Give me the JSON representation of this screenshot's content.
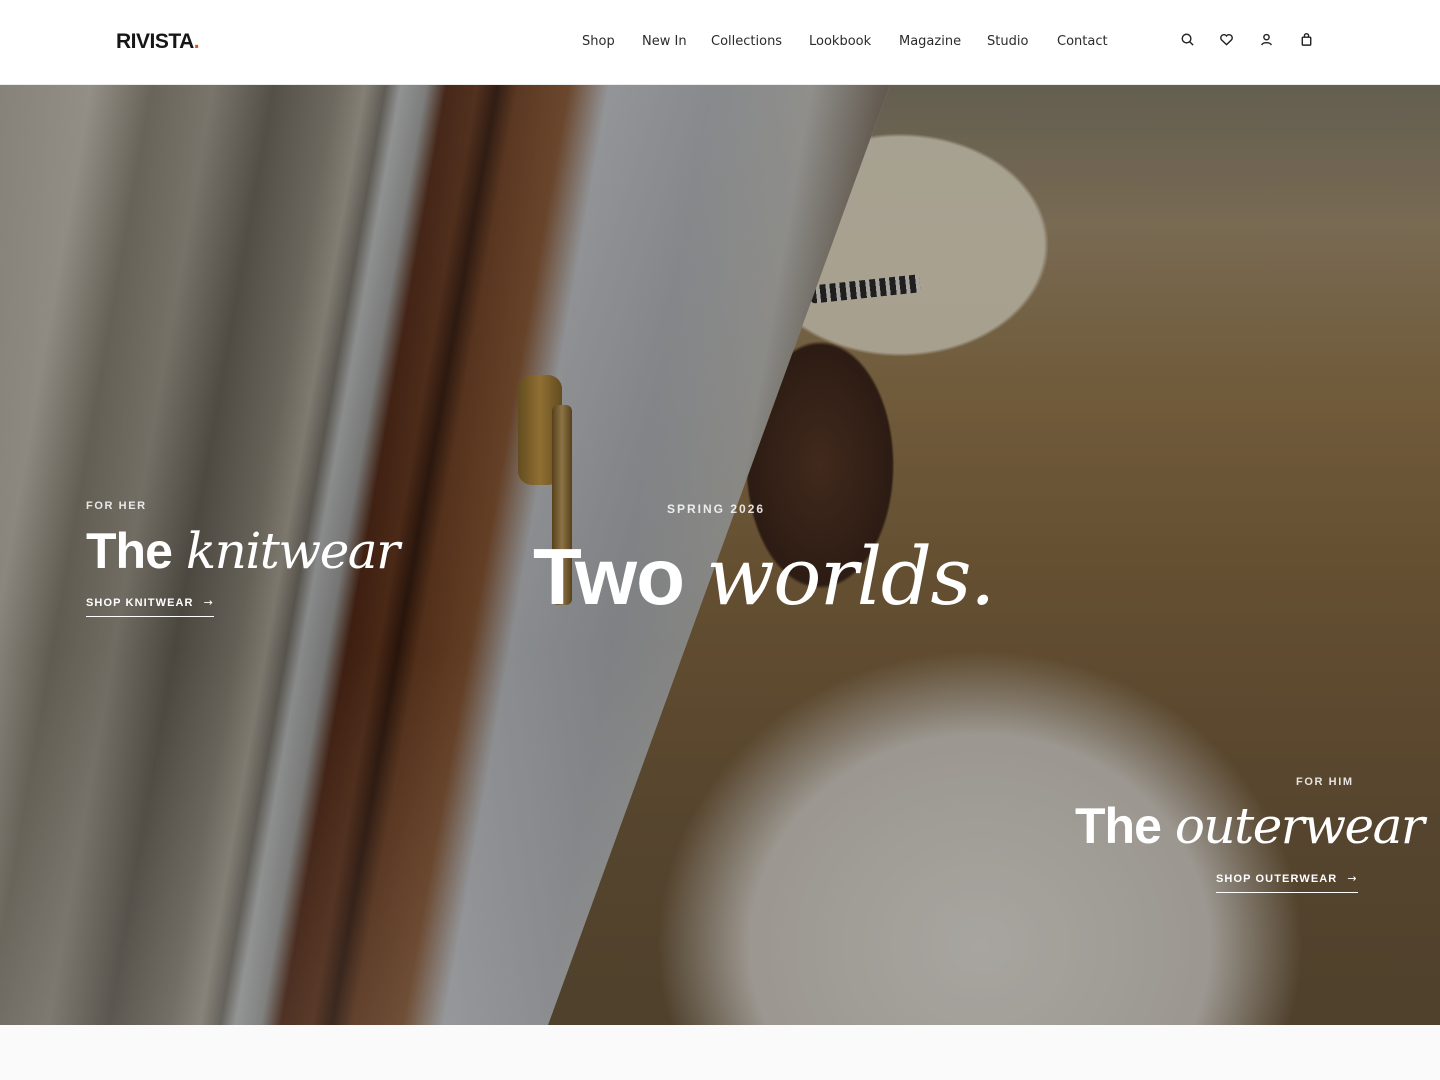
{
  "brand": {
    "name": "RIVISTA",
    "dot": ".",
    "accent_color": "#d9542a"
  },
  "nav": {
    "items": [
      {
        "label": "Shop"
      },
      {
        "label": "New In"
      },
      {
        "label": "Collections"
      },
      {
        "label": "Lookbook"
      },
      {
        "label": "Magazine"
      },
      {
        "label": "Studio"
      },
      {
        "label": "Contact"
      }
    ]
  },
  "header_icons": [
    "search-icon",
    "heart-icon",
    "user-icon",
    "bag-icon"
  ],
  "hero": {
    "center": {
      "eyebrow": "SPRING 2026",
      "title_sans": "Two",
      "title_serif": "worlds."
    },
    "left": {
      "eyebrow": "FOR HER",
      "title_sans": "The",
      "title_serif": "knitwear",
      "cta": "SHOP KNITWEAR"
    },
    "right": {
      "eyebrow": "FOR HIM",
      "title_sans": "The",
      "title_serif": "outerwear",
      "cta": "SHOP OUTERWEAR"
    },
    "arrow": "→"
  }
}
